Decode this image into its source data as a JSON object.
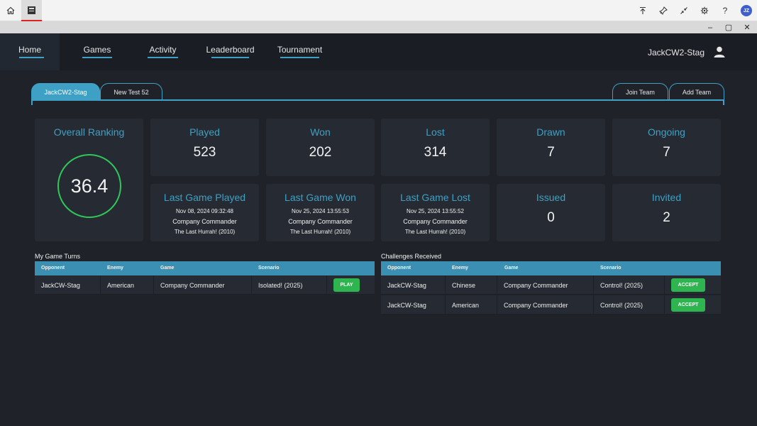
{
  "os": {
    "home_icon": "home-icon",
    "app_icon": "app-window-icon",
    "right_icons": [
      "upload-icon",
      "pin-icon",
      "collapse-icon",
      "gear-icon",
      "help-icon"
    ],
    "help_glyph": "?",
    "avatar_initials": "JZ"
  },
  "window": {
    "minimize": "–",
    "restore": "▢",
    "close": "✕"
  },
  "nav": {
    "items": [
      {
        "label": "Home"
      },
      {
        "label": "Games"
      },
      {
        "label": "Activity"
      },
      {
        "label": "Leaderboard"
      },
      {
        "label": "Tournament"
      }
    ],
    "username": "JackCW2-Stag",
    "user_icon": "user-icon"
  },
  "tabs": {
    "teams": [
      "JackCW2-Stag",
      "New Test 52"
    ],
    "join": "Join Team",
    "add": "Add Team"
  },
  "stats": {
    "ranking": {
      "title": "Overall Ranking",
      "value": "36.4"
    },
    "played": {
      "title": "Played",
      "value": "523"
    },
    "won": {
      "title": "Won",
      "value": "202"
    },
    "lost": {
      "title": "Lost",
      "value": "314"
    },
    "drawn": {
      "title": "Drawn",
      "value": "7"
    },
    "ongoing": {
      "title": "Ongoing",
      "value": "7"
    },
    "last_played": {
      "title": "Last Game Played",
      "date": "Nov 08, 2024 09:32:48",
      "game": "Company Commander",
      "scenario": "The Last Hurrah! (2010)"
    },
    "last_won": {
      "title": "Last Game Won",
      "date": "Nov 25, 2024 13:55:53",
      "game": "Company Commander",
      "scenario": "The Last Hurrah! (2010)"
    },
    "last_lost": {
      "title": "Last Game Lost",
      "date": "Nov 25, 2024 13:55:52",
      "game": "Company Commander",
      "scenario": "The Last Hurrah! (2010)"
    },
    "issued": {
      "title": "Issued",
      "value": "0"
    },
    "invited": {
      "title": "Invited",
      "value": "2"
    }
  },
  "turns": {
    "title": "My Game Turns",
    "headers": [
      "Opponent",
      "Enemy",
      "Game",
      "Scenario"
    ],
    "rows": [
      {
        "opponent": "JackCW-Stag",
        "enemy": "American",
        "game": "Company Commander",
        "scenario": "Isolated! (2025)",
        "action": "PLAY"
      }
    ]
  },
  "challenges": {
    "title": "Challenges Received",
    "headers": [
      "Opponent",
      "Enemy",
      "Game",
      "Scenario"
    ],
    "rows": [
      {
        "opponent": "JackCW-Stag",
        "enemy": "Chinese",
        "game": "Company Commander",
        "scenario": "Control! (2025)",
        "action": "ACCEPT"
      },
      {
        "opponent": "JackCW-Stag",
        "enemy": "American",
        "game": "Company Commander",
        "scenario": "Control! (2025)",
        "action": "ACCEPT"
      }
    ]
  },
  "colors": {
    "accent": "#3ea0c4",
    "success": "#2fb54f",
    "ring": "#2fc65a",
    "background": "#1f2329",
    "card": "#262b33"
  }
}
